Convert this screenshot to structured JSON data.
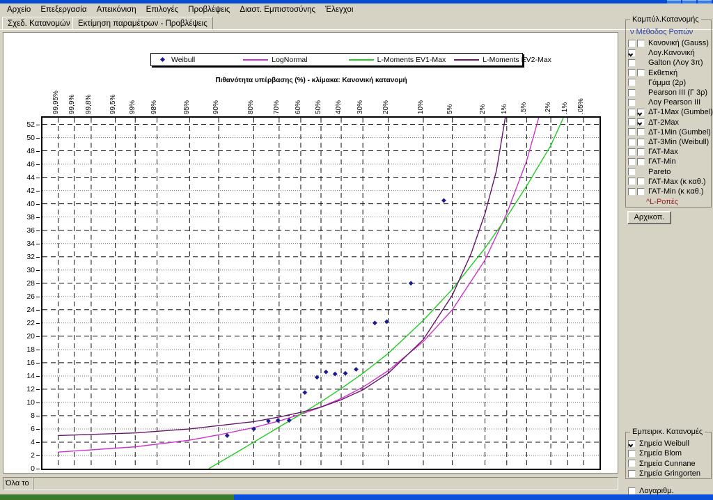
{
  "window": {
    "title_buttons": [
      "minimize",
      "maximize",
      "close"
    ]
  },
  "menubar": {
    "items": [
      {
        "label": "Αρχείο",
        "name": "menu-file"
      },
      {
        "label": "Επεξεργασία",
        "name": "menu-edit"
      },
      {
        "label": "Απεικόνιση",
        "name": "menu-view"
      },
      {
        "label": "Επιλογές",
        "name": "menu-options"
      },
      {
        "label": "Προβλέψεις",
        "name": "menu-predictions"
      },
      {
        "label": "Διαστ. Εμπιστοσύνης",
        "name": "menu-confidence-intervals"
      },
      {
        "label": "Έλεγχοι",
        "name": "menu-tests"
      }
    ]
  },
  "tabs": [
    {
      "label": "Σχεδ. Κατανομών",
      "name": "tab-distribution-plots",
      "selected": true
    },
    {
      "label": "Εκτίμηση παραμέτρων - Προβλέψεις",
      "name": "tab-parameter-estimation",
      "selected": false
    }
  ],
  "panels": {
    "curves": {
      "caption": "Καμπύλ.Κατανομής",
      "method_header": "ν Μέθοδος Ροπών",
      "lmoments_header": "^L-Ροπές",
      "reset_button": "Αρχικοπ.",
      "rows": [
        {
          "label": "Κανονική (Gauss)",
          "cb1": "unchecked",
          "cb2": "unchecked",
          "two": true
        },
        {
          "label": "Λογ.Κανονική",
          "cb1": "checked",
          "cb2": null,
          "two": false
        },
        {
          "label": "Galton (Λογ 3π)",
          "cb1": "unchecked",
          "cb2": null,
          "two": false
        },
        {
          "label": "Εκθετική",
          "cb1": "unchecked",
          "cb2": "unchecked",
          "two": true
        },
        {
          "label": "Γάμμα (2ρ)",
          "cb1": "unchecked",
          "cb2": null,
          "two": false
        },
        {
          "label": "Pearson III (Γ 3ρ)",
          "cb1": "unchecked",
          "cb2": null,
          "two": false
        },
        {
          "label": "Λογ Pearson III",
          "cb1": "unchecked",
          "cb2": null,
          "two": false
        },
        {
          "label": "ΔΤ-1Max (Gumbel)",
          "cb1": "unchecked",
          "cb2": "checked",
          "two": true
        },
        {
          "label": "ΔΤ-2Max",
          "cb1": "unchecked",
          "cb2": "checked",
          "two": true
        },
        {
          "label": "ΔΤ-1Min (Gumbel)",
          "cb1": "unchecked",
          "cb2": "unchecked",
          "two": true
        },
        {
          "label": "ΔΤ-3Min (Weibull)",
          "cb1": "unchecked",
          "cb2": "unchecked",
          "two": true
        },
        {
          "label": "ΓΑΤ-Max",
          "cb1": "unchecked",
          "cb2": "unchecked",
          "two": true
        },
        {
          "label": "ΓΑΤ-Min",
          "cb1": "unchecked",
          "cb2": "unchecked",
          "two": true
        },
        {
          "label": "Pareto",
          "cb1": "unchecked",
          "cb2": null,
          "two": false
        },
        {
          "label": "ΓΑΤ-Max (κ καθ.)",
          "cb1": "unchecked",
          "cb2": "unchecked",
          "two": true
        },
        {
          "label": "ΓΑΤ-Min (κ καθ.)",
          "cb1": "unchecked",
          "cb2": "unchecked",
          "two": true
        }
      ]
    },
    "empirical": {
      "caption": "Εμπειρικ. Κατανομές",
      "rows": [
        {
          "label": "Σημεία Weibull",
          "state": "checked"
        },
        {
          "label": "Σημεία Blom",
          "state": "unchecked"
        },
        {
          "label": "Σημεία Cunnane",
          "state": "unchecked"
        },
        {
          "label": "Σημεία Gringorten",
          "state": "unchecked"
        }
      ]
    },
    "log_checkbox": {
      "label": "Λογαριθμ.",
      "state": "unchecked"
    }
  },
  "statusbar": {
    "left_cell": "Όλα το",
    "right_cell": ""
  },
  "chart_data": {
    "type": "scatter",
    "title": "",
    "subtitle": "Πιθανότητα υπέρβασης (%) - κλίμακα: Κανονική κατανομή",
    "xlabel": "Πιθανότητα υπέρβασης (%)",
    "ylabel": "",
    "x_scale": "normal-probability",
    "x_tick_labels": [
      "99,95%",
      "99,9%",
      "99,8%",
      "99,5%",
      "99%",
      "98%",
      "95%",
      "90%",
      "80%",
      "70%",
      "60%",
      "50%",
      "40%",
      "30%",
      "20%",
      "10%",
      "5%",
      "2%",
      "1%",
      ".5%",
      ".2%",
      ".1%",
      ".05%"
    ],
    "x_tick_probs": [
      99.95,
      99.9,
      99.8,
      99.5,
      99,
      98,
      95,
      90,
      80,
      70,
      60,
      50,
      40,
      30,
      20,
      10,
      5,
      2,
      1,
      0.5,
      0.2,
      0.1,
      0.05
    ],
    "ylim": [
      0,
      53
    ],
    "y_ticks": [
      0,
      2,
      4,
      6,
      8,
      10,
      12,
      14,
      16,
      18,
      20,
      22,
      24,
      26,
      28,
      30,
      32,
      34,
      36,
      38,
      40,
      42,
      44,
      46,
      48,
      50,
      52
    ],
    "grid": true,
    "legend_position": "top-center",
    "legend": [
      {
        "name": "Weibull",
        "marker": "diamond",
        "color": "#1b1b8f"
      },
      {
        "name": "LogNormal",
        "marker": "line",
        "color": "#cc33cc"
      },
      {
        "name": "L-Moments EV1-Max",
        "marker": "line",
        "color": "#22cc22"
      },
      {
        "name": "L-Moments EV2-Max",
        "marker": "line",
        "color": "#66156b"
      }
    ],
    "series": [
      {
        "name": "Weibull",
        "type": "scatter",
        "color": "#1b1b8f",
        "points": [
          {
            "p": 88.0,
            "y": 5.0
          },
          {
            "p": 80.0,
            "y": 6.0
          },
          {
            "p": 74.5,
            "y": 7.2
          },
          {
            "p": 70.5,
            "y": 7.3
          },
          {
            "p": 65.5,
            "y": 7.3
          },
          {
            "p": 58.0,
            "y": 11.5
          },
          {
            "p": 52.0,
            "y": 13.8
          },
          {
            "p": 47.5,
            "y": 14.6
          },
          {
            "p": 43.0,
            "y": 14.3
          },
          {
            "p": 38.0,
            "y": 14.4
          },
          {
            "p": 33.0,
            "y": 15.0
          },
          {
            "p": 25.0,
            "y": 22.0
          },
          {
            "p": 20.5,
            "y": 22.2
          },
          {
            "p": 13.0,
            "y": 28.0
          },
          {
            "p": 6.2,
            "y": 40.5
          }
        ]
      },
      {
        "name": "LogNormal",
        "type": "line",
        "color": "#cc33cc",
        "curve": [
          {
            "p": 99.95,
            "y": 2.5
          },
          {
            "p": 99.0,
            "y": 3.3
          },
          {
            "p": 95.0,
            "y": 4.3
          },
          {
            "p": 90.0,
            "y": 5.1
          },
          {
            "p": 80.0,
            "y": 6.2
          },
          {
            "p": 70.0,
            "y": 7.2
          },
          {
            "p": 60.0,
            "y": 8.2
          },
          {
            "p": 50.0,
            "y": 9.3
          },
          {
            "p": 40.0,
            "y": 10.6
          },
          {
            "p": 30.0,
            "y": 12.3
          },
          {
            "p": 20.0,
            "y": 14.8
          },
          {
            "p": 10.0,
            "y": 19.2
          },
          {
            "p": 5.0,
            "y": 24.0
          },
          {
            "p": 2.0,
            "y": 31.5
          },
          {
            "p": 1.0,
            "y": 38.5
          },
          {
            "p": 0.5,
            "y": 46.5
          },
          {
            "p": 0.32,
            "y": 53.0
          }
        ]
      },
      {
        "name": "L-Moments EV1-Max",
        "type": "line",
        "color": "#22cc22",
        "curve": [
          {
            "p": 92.0,
            "y": 0.0
          },
          {
            "p": 85.0,
            "y": 2.6
          },
          {
            "p": 80.0,
            "y": 4.0
          },
          {
            "p": 70.0,
            "y": 6.3
          },
          {
            "p": 60.0,
            "y": 8.2
          },
          {
            "p": 50.0,
            "y": 10.1
          },
          {
            "p": 40.0,
            "y": 12.1
          },
          {
            "p": 30.0,
            "y": 14.4
          },
          {
            "p": 20.0,
            "y": 17.4
          },
          {
            "p": 10.0,
            "y": 22.4
          },
          {
            "p": 5.0,
            "y": 27.1
          },
          {
            "p": 2.0,
            "y": 33.3
          },
          {
            "p": 1.0,
            "y": 38.0
          },
          {
            "p": 0.5,
            "y": 42.7
          },
          {
            "p": 0.2,
            "y": 48.8
          },
          {
            "p": 0.12,
            "y": 53.0
          }
        ]
      },
      {
        "name": "L-Moments EV2-Max",
        "type": "line",
        "color": "#66156b",
        "curve": [
          {
            "p": 99.95,
            "y": 5.0
          },
          {
            "p": 99.0,
            "y": 5.4
          },
          {
            "p": 95.0,
            "y": 6.0
          },
          {
            "p": 90.0,
            "y": 6.5
          },
          {
            "p": 80.0,
            "y": 7.1
          },
          {
            "p": 70.0,
            "y": 7.8
          },
          {
            "p": 60.0,
            "y": 8.5
          },
          {
            "p": 50.0,
            "y": 9.3
          },
          {
            "p": 40.0,
            "y": 10.4
          },
          {
            "p": 30.0,
            "y": 11.9
          },
          {
            "p": 20.0,
            "y": 14.4
          },
          {
            "p": 10.0,
            "y": 19.5
          },
          {
            "p": 5.0,
            "y": 26.2
          },
          {
            "p": 3.0,
            "y": 32.5
          },
          {
            "p": 2.0,
            "y": 38.5
          },
          {
            "p": 1.4,
            "y": 45.0
          },
          {
            "p": 1.05,
            "y": 53.0
          }
        ]
      }
    ]
  }
}
